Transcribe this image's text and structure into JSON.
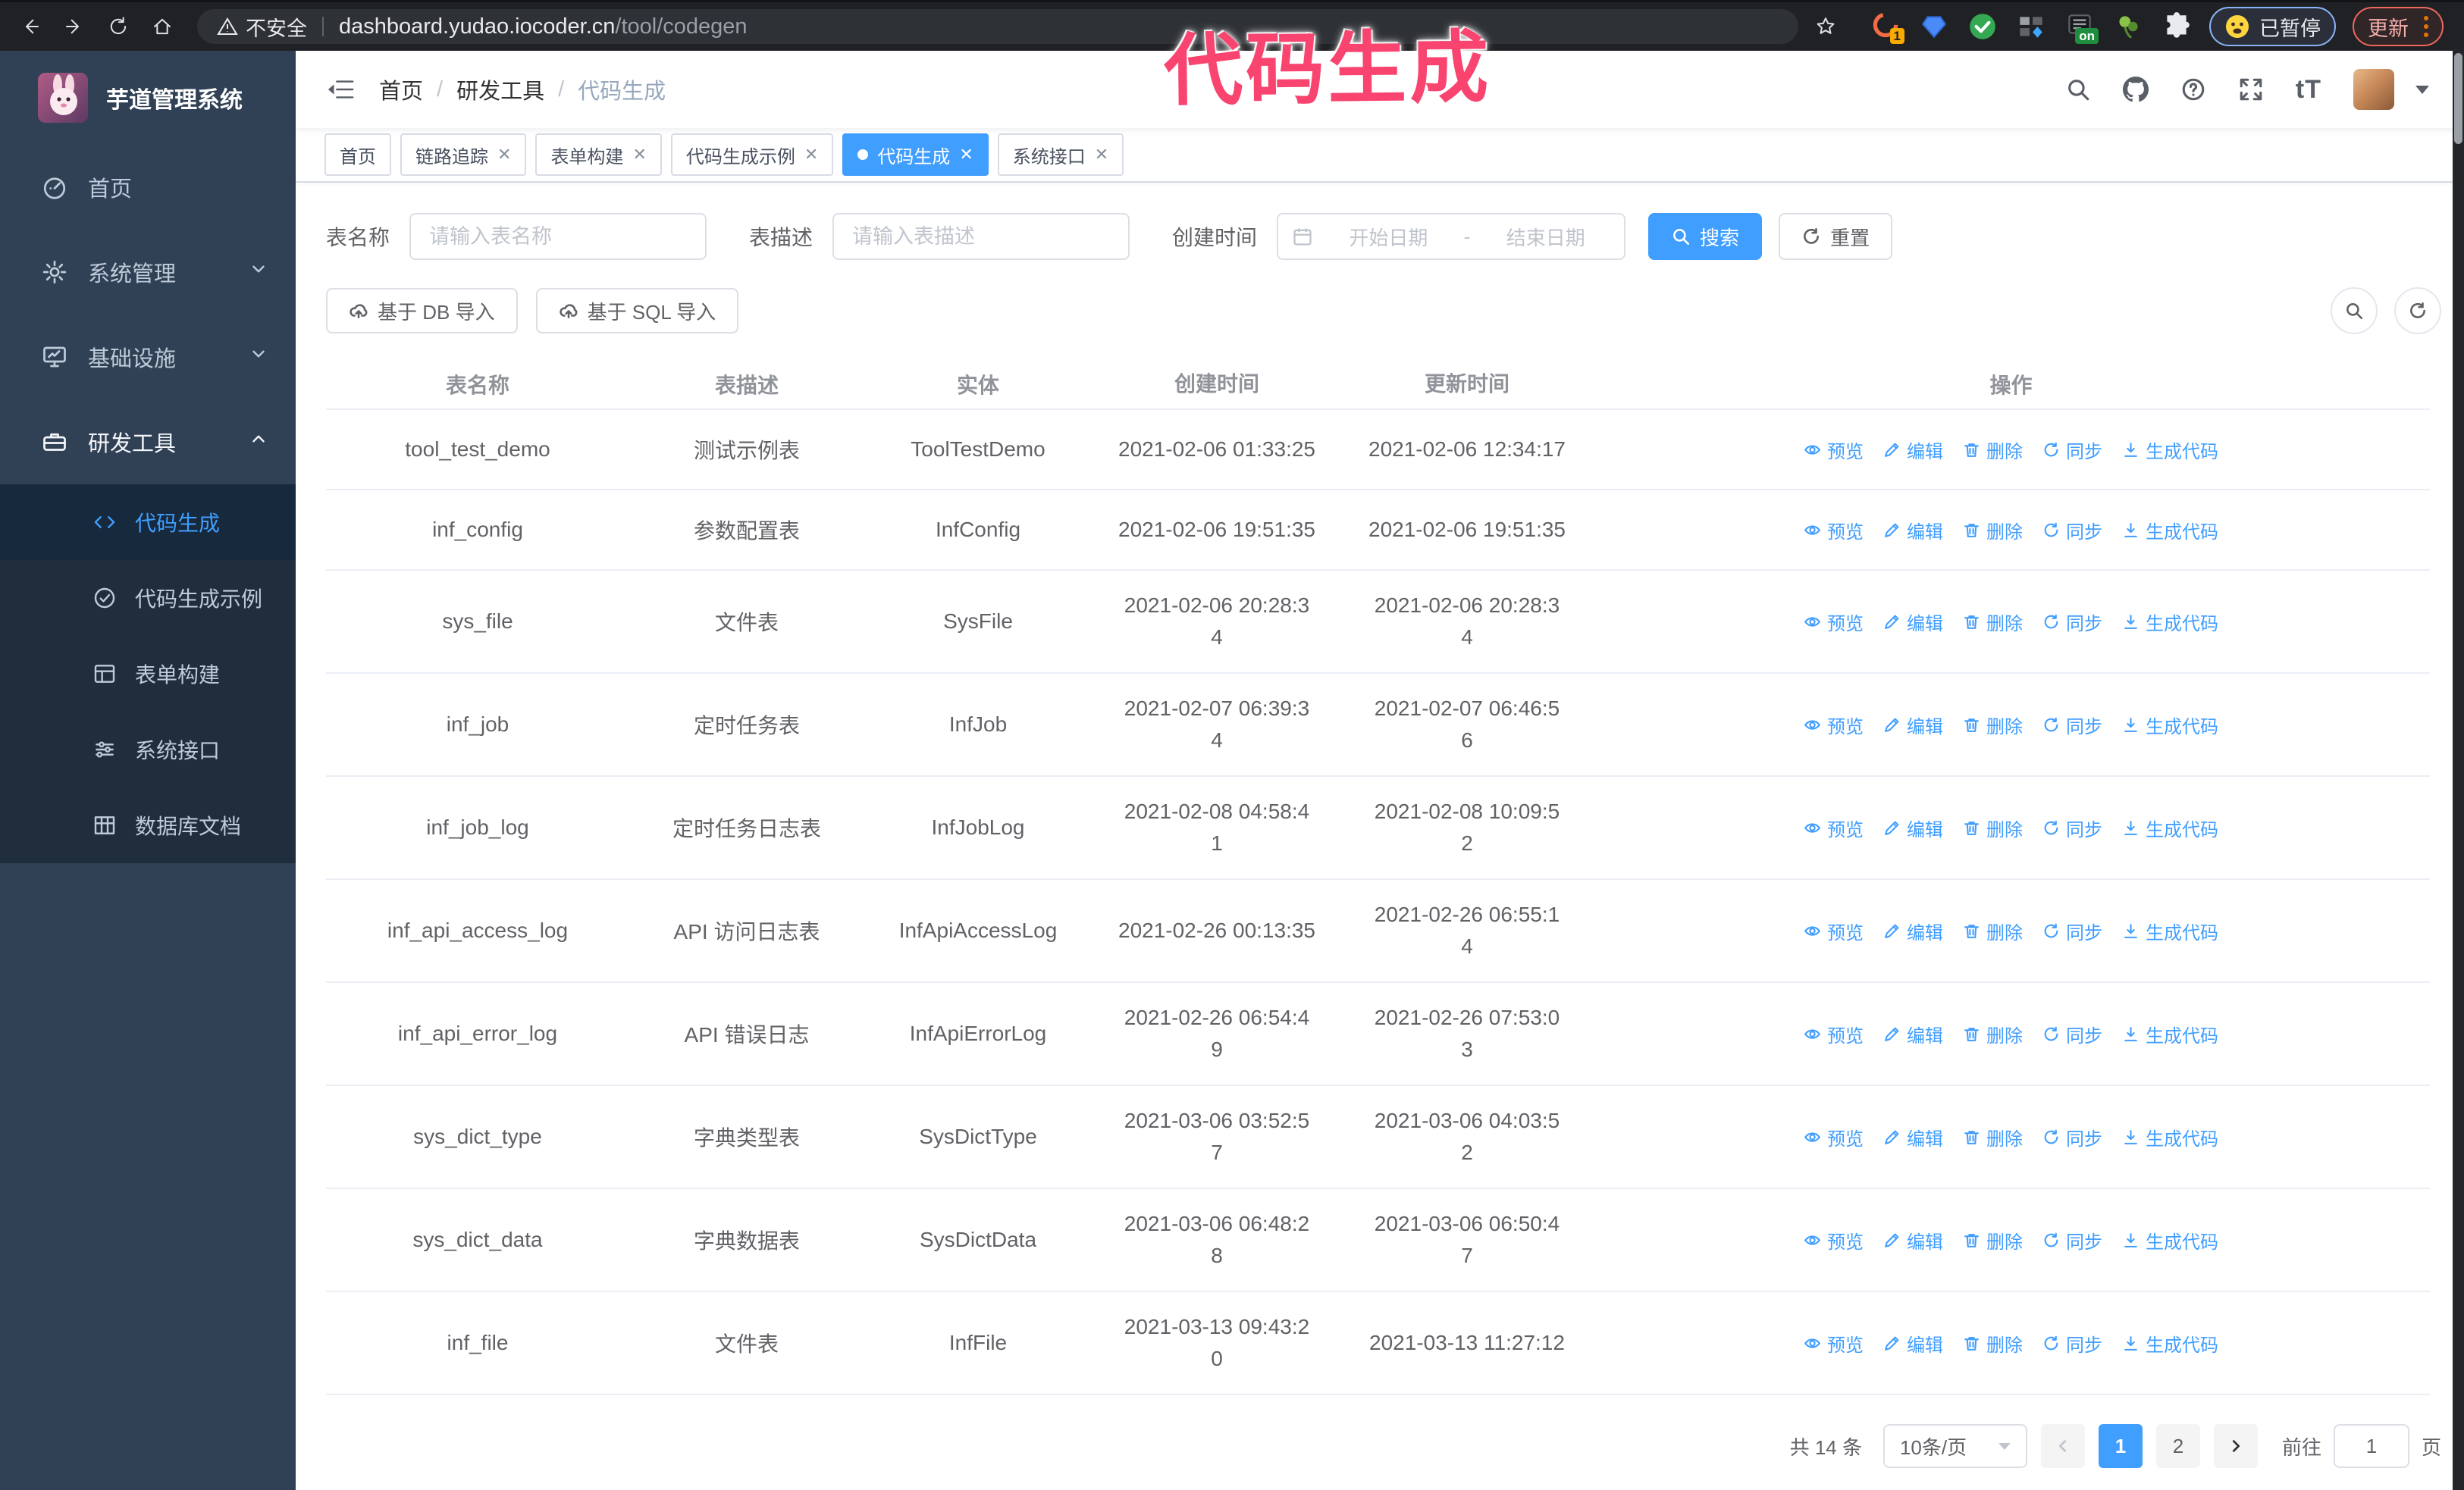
{
  "browser": {
    "security_label": "不安全",
    "url_domain": "dashboard.yudao.iocoder.cn",
    "url_path": "/tool/codegen",
    "extension_badge": "1",
    "extension_on_badge": "on",
    "profile_status": "已暂停",
    "update_label": "更新"
  },
  "annotation": {
    "text": "代码生成",
    "color": "#f8446f"
  },
  "sidebar": {
    "logo_title": "芋道管理系统",
    "items": [
      {
        "label": "首页",
        "icon": "dashboard-icon",
        "expandable": false
      },
      {
        "label": "系统管理",
        "icon": "gear-icon",
        "expandable": true
      },
      {
        "label": "基础设施",
        "icon": "monitor-icon",
        "expandable": true
      },
      {
        "label": "研发工具",
        "icon": "briefcase-icon",
        "expandable": true,
        "expanded": true
      }
    ],
    "sub_items": [
      {
        "label": "代码生成",
        "icon": "code-icon",
        "active": true
      },
      {
        "label": "代码生成示例",
        "icon": "check-circle-icon",
        "active": false
      },
      {
        "label": "表单构建",
        "icon": "form-icon",
        "active": false
      },
      {
        "label": "系统接口",
        "icon": "sliders-icon",
        "active": false
      },
      {
        "label": "数据库文档",
        "icon": "grid-icon",
        "active": false
      }
    ]
  },
  "header": {
    "breadcrumb": [
      "首页",
      "研发工具",
      "代码生成"
    ],
    "breadcrumb_separator": "/",
    "font_icon_text": "tT"
  },
  "tags": [
    {
      "label": "首页",
      "closable": false,
      "active": false
    },
    {
      "label": "链路追踪",
      "closable": true,
      "active": false
    },
    {
      "label": "表单构建",
      "closable": true,
      "active": false
    },
    {
      "label": "代码生成示例",
      "closable": true,
      "active": false
    },
    {
      "label": "代码生成",
      "closable": true,
      "active": true
    },
    {
      "label": "系统接口",
      "closable": true,
      "active": false
    }
  ],
  "search": {
    "name_label": "表名称",
    "name_placeholder": "请输入表名称",
    "desc_label": "表描述",
    "desc_placeholder": "请输入表描述",
    "time_label": "创建时间",
    "start_placeholder": "开始日期",
    "range_separator": "-",
    "end_placeholder": "结束日期",
    "search_label": "搜索",
    "reset_label": "重置"
  },
  "toolbar": {
    "db_import_label": "基于 DB 导入",
    "sql_import_label": "基于 SQL 导入"
  },
  "table": {
    "columns": [
      "表名称",
      "表描述",
      "实体",
      "创建时间",
      "更新时间",
      "操作"
    ],
    "row_actions": [
      "预览",
      "编辑",
      "删除",
      "同步",
      "生成代码"
    ],
    "row_action_icons": [
      "eye-icon",
      "pencil-icon",
      "trash-icon",
      "sync-icon",
      "download-icon"
    ],
    "rows": [
      {
        "name": "tool_test_demo",
        "desc": "测试示例表",
        "entity": "ToolTestDemo",
        "created": "2021-02-06 01:33:25",
        "updated": "2021-02-06 12:34:17"
      },
      {
        "name": "inf_config",
        "desc": "参数配置表",
        "entity": "InfConfig",
        "created": "2021-02-06 19:51:35",
        "updated": "2021-02-06 19:51:35"
      },
      {
        "name": "sys_file",
        "desc": "文件表",
        "entity": "SysFile",
        "created": "2021-02-06 20:28:3\n4",
        "updated": "2021-02-06 20:28:3\n4"
      },
      {
        "name": "inf_job",
        "desc": "定时任务表",
        "entity": "InfJob",
        "created": "2021-02-07 06:39:3\n4",
        "updated": "2021-02-07 06:46:5\n6"
      },
      {
        "name": "inf_job_log",
        "desc": "定时任务日志表",
        "entity": "InfJobLog",
        "created": "2021-02-08 04:58:4\n1",
        "updated": "2021-02-08 10:09:5\n2"
      },
      {
        "name": "inf_api_access_log",
        "desc": "API 访问日志表",
        "entity": "InfApiAccessLog",
        "created": "2021-02-26 00:13:35",
        "updated": "2021-02-26 06:55:1\n4"
      },
      {
        "name": "inf_api_error_log",
        "desc": "API 错误日志",
        "entity": "InfApiErrorLog",
        "created": "2021-02-26 06:54:4\n9",
        "updated": "2021-02-26 07:53:0\n3"
      },
      {
        "name": "sys_dict_type",
        "desc": "字典类型表",
        "entity": "SysDictType",
        "created": "2021-03-06 03:52:5\n7",
        "updated": "2021-03-06 04:03:5\n2"
      },
      {
        "name": "sys_dict_data",
        "desc": "字典数据表",
        "entity": "SysDictData",
        "created": "2021-03-06 06:48:2\n8",
        "updated": "2021-03-06 06:50:4\n7"
      },
      {
        "name": "inf_file",
        "desc": "文件表",
        "entity": "InfFile",
        "created": "2021-03-13 09:43:2\n0",
        "updated": "2021-03-13 11:27:12"
      }
    ]
  },
  "pagination": {
    "total": "共 14 条",
    "page_size": "10条/页",
    "pages": [
      "1",
      "2"
    ],
    "current": "1",
    "goto_label": "前往",
    "goto_value": "1",
    "goto_suffix": "页"
  },
  "colors": {
    "accent": "#409EFF",
    "sidebar_bg": "#304156",
    "submenu_bg": "#1f2d3d",
    "browser_bar": "#202124",
    "annotation": "#f8446f",
    "table_border": "#ebeef5"
  }
}
